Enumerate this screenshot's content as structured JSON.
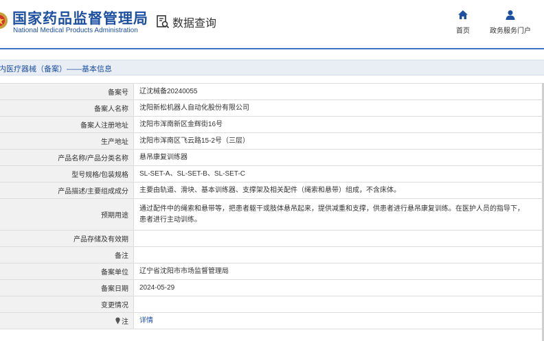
{
  "header": {
    "brand_cn": "国家药品监督管理局",
    "brand_en": "National Medical Products Administration",
    "query_label": "数据查询",
    "nav": [
      {
        "label": "首页",
        "icon": "home-icon"
      },
      {
        "label": "政务服务门户",
        "icon": "user-icon"
      }
    ]
  },
  "section": {
    "title": "内医疗器械（备案）——基本信息"
  },
  "table": {
    "rows": [
      {
        "key": "备案号",
        "value": "辽沈械备20240055"
      },
      {
        "key": "备案人名称",
        "value": "沈阳新松机器人自动化股份有限公司"
      },
      {
        "key": "备案人注册地址",
        "value": "沈阳市浑南新区金辉街16号"
      },
      {
        "key": "生产地址",
        "value": "沈阳市浑南区飞云路15-2号（三层）"
      },
      {
        "key": "产品名称/产品分类名称",
        "value": "悬吊康复训练器"
      },
      {
        "key": "型号规格/包装规格",
        "value": "SL-SET-A、SL-SET-B、SL-SET-C"
      },
      {
        "key": "产品描述/主要组成成分",
        "value": "主要由轨道、滑块、基本训练器、支撑架及相关配件（绳索和悬带）组成，不含床体。"
      },
      {
        "key": "预期用途",
        "value": "通过配件中的绳索和悬带等，把患者躯干或肢体悬吊起来，提供减重和支撑，供患者进行悬吊康复训练。在医护人员的指导下，患者进行主动训练。"
      },
      {
        "key": "产品存储及有效期",
        "value": ""
      },
      {
        "key": "备注",
        "value": ""
      },
      {
        "key": "备案单位",
        "value": "辽宁省沈阳市市场监督管理局"
      },
      {
        "key": "备案日期",
        "value": "2024-05-29"
      },
      {
        "key": "变更情况",
        "value": ""
      },
      {
        "key": "注",
        "value": "详情"
      }
    ]
  },
  "colors": {
    "brand_blue": "#1e50a2",
    "accent_line": "#3a73c4",
    "label_bg": "#f1f1f1"
  }
}
